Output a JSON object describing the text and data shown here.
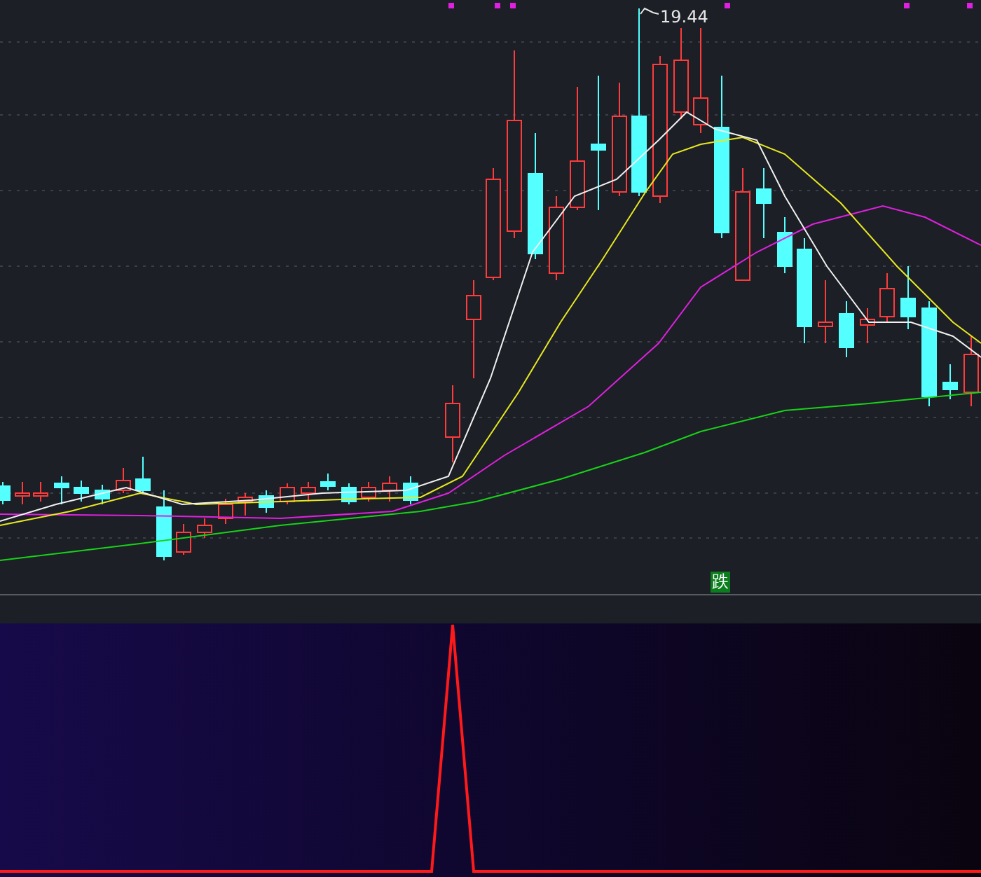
{
  "price_panel": {
    "high_label": "19.44",
    "signal_badge": "跌"
  }
}
